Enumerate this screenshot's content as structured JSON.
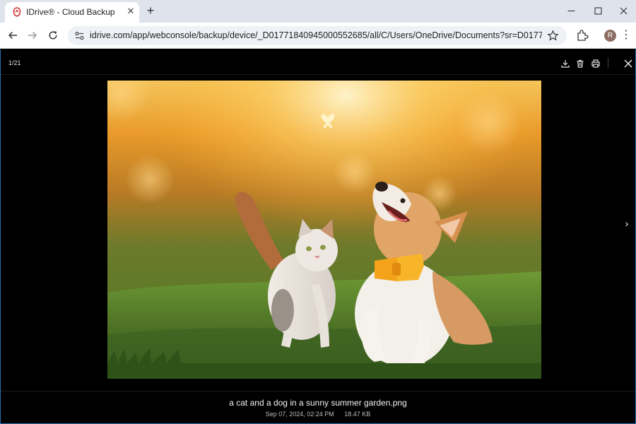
{
  "browser": {
    "tab_title": "IDrive® - Cloud Backup",
    "new_tab_label": "+",
    "url": "idrive.com/app/webconsole/backup/device/_D01771840945000552685/all/C/Users/OneDrive/Documents?sr=D01771840945000",
    "profile_initial": "R",
    "brand_color": "#d6312f"
  },
  "viewer": {
    "counter": "1/21",
    "next_label": "›",
    "file_name": "a cat and a dog in a sunny summer garden.png",
    "file_date": "Sep 07, 2024, 02:24 PM",
    "file_size": "18.47 KB",
    "icons": [
      "download-icon",
      "delete-icon",
      "print-icon",
      "close-icon"
    ]
  }
}
